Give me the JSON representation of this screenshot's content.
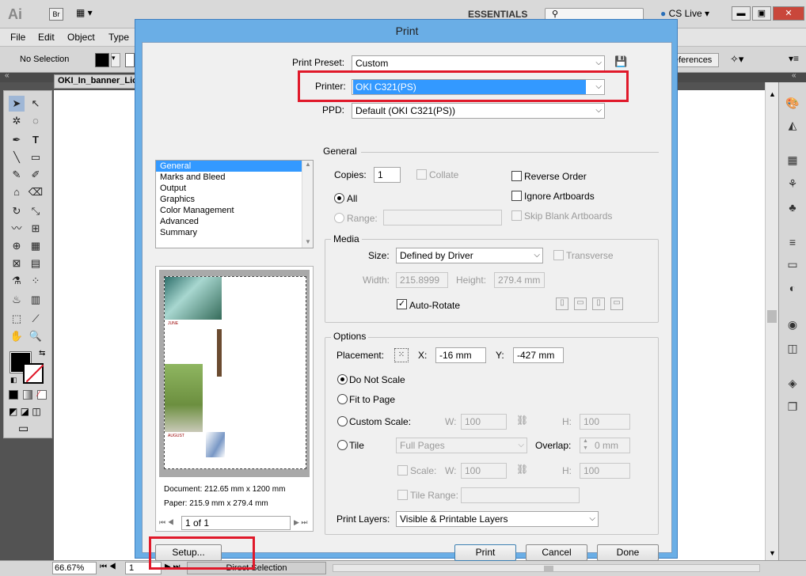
{
  "app": {
    "logo": "Ai",
    "bridge_label": "Br",
    "workspace": "ESSENTIALS",
    "cs_live": "CS Live",
    "menu": [
      "File",
      "Edit",
      "Object",
      "Type"
    ],
    "selection_status": "No Selection",
    "preferences_label": "eferences",
    "doc_tab": "OKI_In_banner_Lic",
    "zoom": "66.67%",
    "page": "1",
    "tool_status": "Direct Selection"
  },
  "dialog": {
    "title": "Print",
    "print_preset_label": "Print Preset:",
    "print_preset_value": "Custom",
    "printer_label": "Printer:",
    "printer_value": "OKI C321(PS)",
    "ppd_label": "PPD:",
    "ppd_value": "Default (OKI C321(PS))",
    "categories": [
      "General",
      "Marks and Bleed",
      "Output",
      "Graphics",
      "Color Management",
      "Advanced",
      "Summary"
    ],
    "selected_category": "General",
    "general_heading": "General",
    "copies_label": "Copies:",
    "copies_value": "1",
    "collate_label": "Collate",
    "reverse_order_label": "Reverse Order",
    "all_label": "All",
    "range_label": "Range:",
    "ignore_artboards_label": "Ignore Artboards",
    "skip_blank_label": "Skip Blank Artboards",
    "media_heading": "Media",
    "size_label": "Size:",
    "size_value": "Defined by Driver",
    "transverse_label": "Transverse",
    "width_label": "Width:",
    "width_value": "215.8999",
    "height_label": "Height:",
    "height_value": "279.4 mm",
    "auto_rotate_label": "Auto-Rotate",
    "options_heading": "Options",
    "placement_label": "Placement:",
    "x_label": "X:",
    "x_value": "-16 mm",
    "y_label": "Y:",
    "y_value": "-427 mm",
    "do_not_scale_label": "Do Not Scale",
    "fit_to_page_label": "Fit to Page",
    "custom_scale_label": "Custom Scale:",
    "w_label": "W:",
    "h_label": "H:",
    "scale_w_value": "100",
    "scale_h_value": "100",
    "tile_label": "Tile",
    "tile_value": "Full Pages",
    "overlap_label": "Overlap:",
    "overlap_value": "0 mm",
    "scale_label": "Scale:",
    "tile_scale_w_value": "100",
    "tile_scale_h_value": "100",
    "tile_range_label": "Tile Range:",
    "print_layers_label": "Print Layers:",
    "print_layers_value": "Visible & Printable Layers",
    "document_info": "Document: 212.65 mm x 1200 mm",
    "paper_info": "Paper: 215.9 mm x 279.4 mm",
    "page_nav_value": "1 of 1",
    "calendar_month_1": "JUNE",
    "calendar_month_2": "AUGUST",
    "setup_button": "Setup...",
    "print_button": "Print",
    "cancel_button": "Cancel",
    "done_button": "Done",
    "highlight_color": "#e0192a"
  }
}
